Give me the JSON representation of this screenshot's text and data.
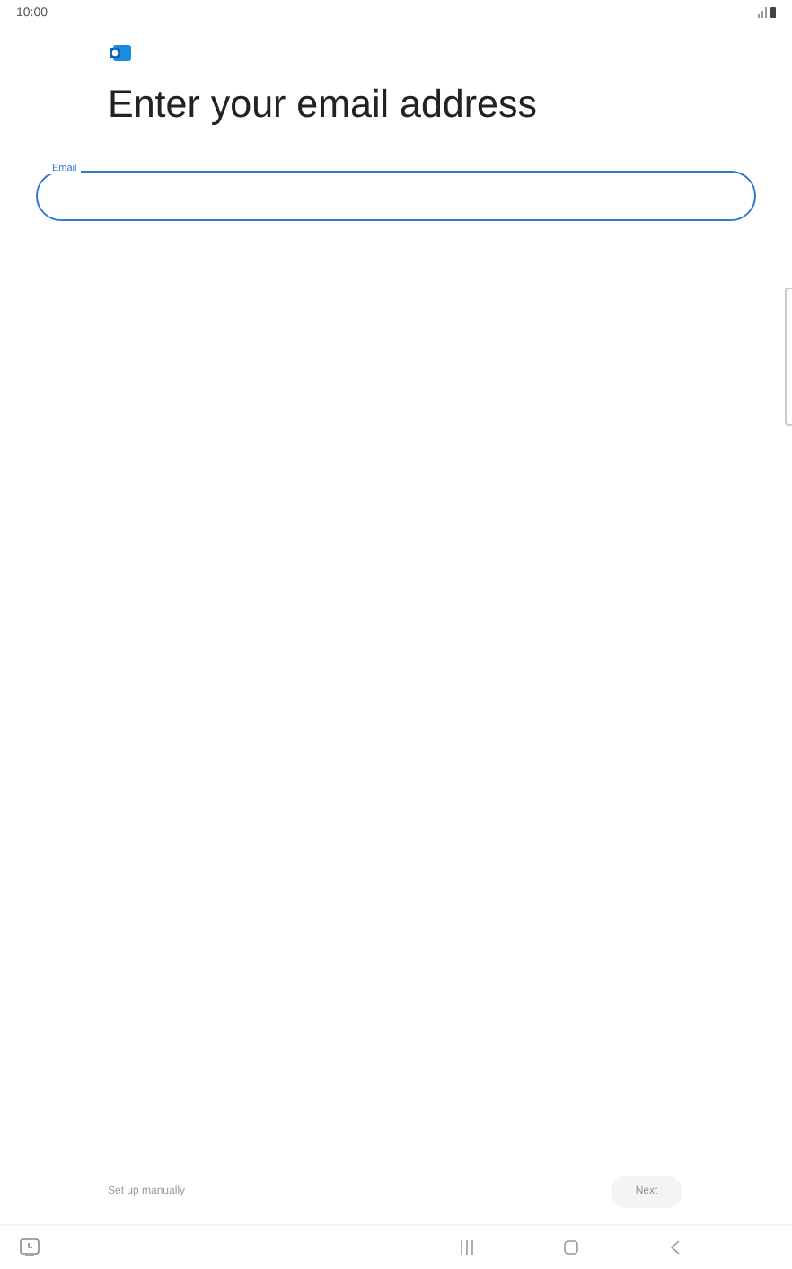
{
  "status_bar": {
    "time": "10:00"
  },
  "title": "Enter your email address",
  "email_field": {
    "label": "Email",
    "focused": true
  },
  "actions": [
    {
      "label": "Set up manually",
      "kind": "link",
      "disabled": true
    },
    {
      "label": "Next",
      "kind": "pill",
      "disabled": true
    }
  ]
}
